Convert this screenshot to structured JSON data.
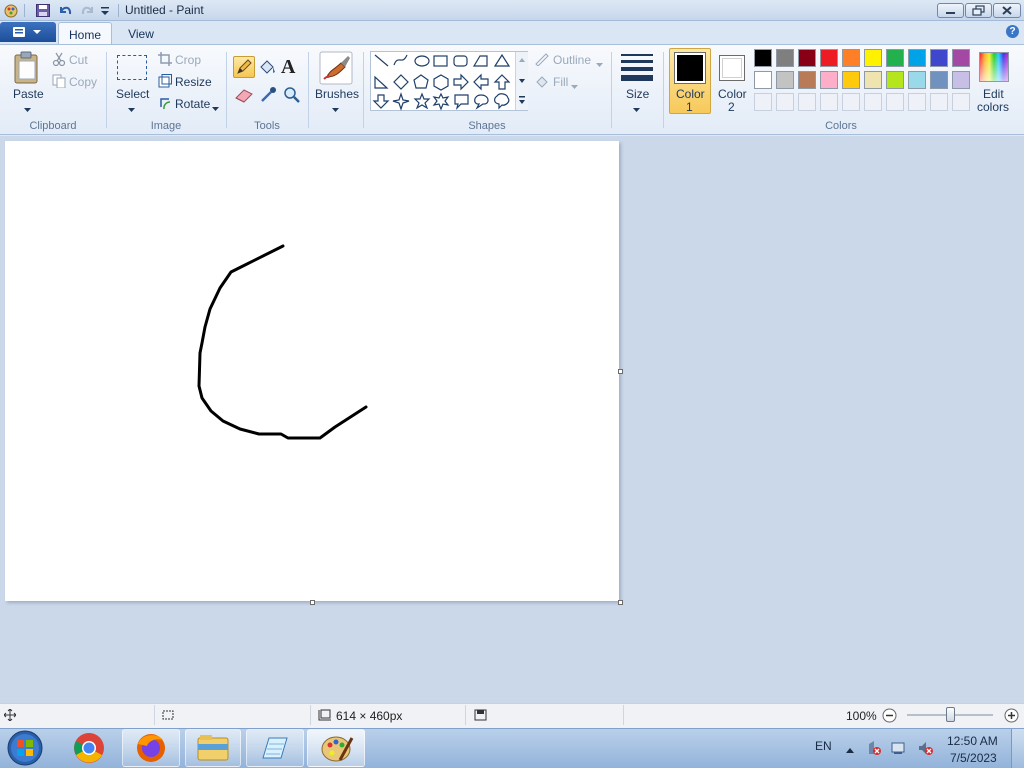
{
  "window": {
    "title": "Untitled - Paint"
  },
  "tabs": [
    {
      "label": "Home"
    },
    {
      "label": "View"
    }
  ],
  "clipboard": {
    "paste": "Paste",
    "cut": "Cut",
    "copy": "Copy",
    "group": "Clipboard"
  },
  "image": {
    "select": "Select",
    "crop": "Crop",
    "resize": "Resize",
    "rotate": "Rotate",
    "group": "Image"
  },
  "tools": {
    "group": "Tools",
    "text_glyph": "A"
  },
  "brushes": {
    "label": "Brushes"
  },
  "shapes": {
    "outline": "Outline",
    "fill": "Fill",
    "group": "Shapes"
  },
  "size": {
    "label": "Size"
  },
  "color1": {
    "line1": "Color",
    "line2": "1",
    "value": "#000000"
  },
  "color2": {
    "line1": "Color",
    "line2": "2",
    "value": "#ffffff"
  },
  "colors": {
    "group": "Colors",
    "edit_line1": "Edit",
    "edit_line2": "colors",
    "row1": [
      "#000000",
      "#7f7f7f",
      "#880015",
      "#ed1c24",
      "#ff7f27",
      "#fff200",
      "#22b14c",
      "#00a2e8",
      "#3f48cc",
      "#a349a4"
    ],
    "row2": [
      "#ffffff",
      "#c3c3c3",
      "#b97a57",
      "#ffaec9",
      "#ffc90e",
      "#efe4b0",
      "#b5e61d",
      "#99d9ea",
      "#7092be",
      "#c8bfe7"
    ],
    "row3_count": 10
  },
  "canvas": {
    "background": "#ffffff",
    "stroke_color": "#000000"
  },
  "status": {
    "dimensions": "614 × 460px",
    "zoom": "100%"
  },
  "taskbar": {
    "lang": "EN",
    "time": "12:50 AM",
    "date": "7/5/2023"
  }
}
